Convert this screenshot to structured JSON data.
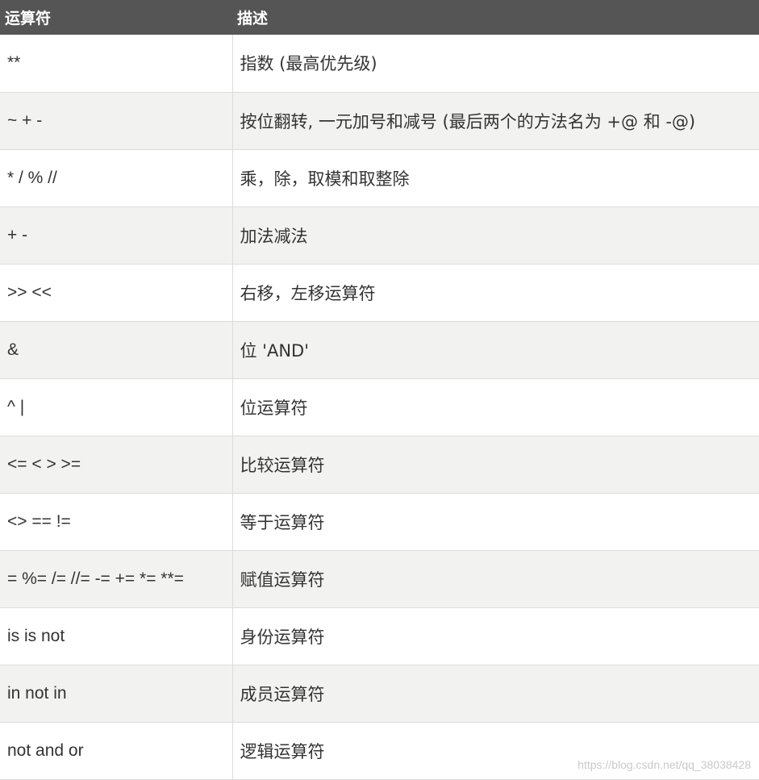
{
  "table": {
    "headers": [
      "运算符",
      "描述"
    ],
    "rows": [
      {
        "op": "**",
        "desc": "指数 (最高优先级)"
      },
      {
        "op": "~ + -",
        "desc": "按位翻转, 一元加号和减号 (最后两个的方法名为 +@ 和 -@)"
      },
      {
        "op": "* / % //",
        "desc": "乘，除，取模和取整除"
      },
      {
        "op": "+ -",
        "desc": "加法减法"
      },
      {
        "op": ">> <<",
        "desc": "右移，左移运算符"
      },
      {
        "op": "&",
        "desc": "位 'AND'"
      },
      {
        "op": "^ |",
        "desc": "位运算符"
      },
      {
        "op": "<= < > >=",
        "desc": "比较运算符"
      },
      {
        "op": "<> == !=",
        "desc": "等于运算符"
      },
      {
        "op": "= %= /= //= -= += *= **=",
        "desc": "赋值运算符"
      },
      {
        "op": "is is not",
        "desc": "身份运算符"
      },
      {
        "op": "in not in",
        "desc": "成员运算符"
      },
      {
        "op": "not and or",
        "desc": "逻辑运算符"
      }
    ]
  },
  "watermark": "https://blog.csdn.net/qq_38038428"
}
